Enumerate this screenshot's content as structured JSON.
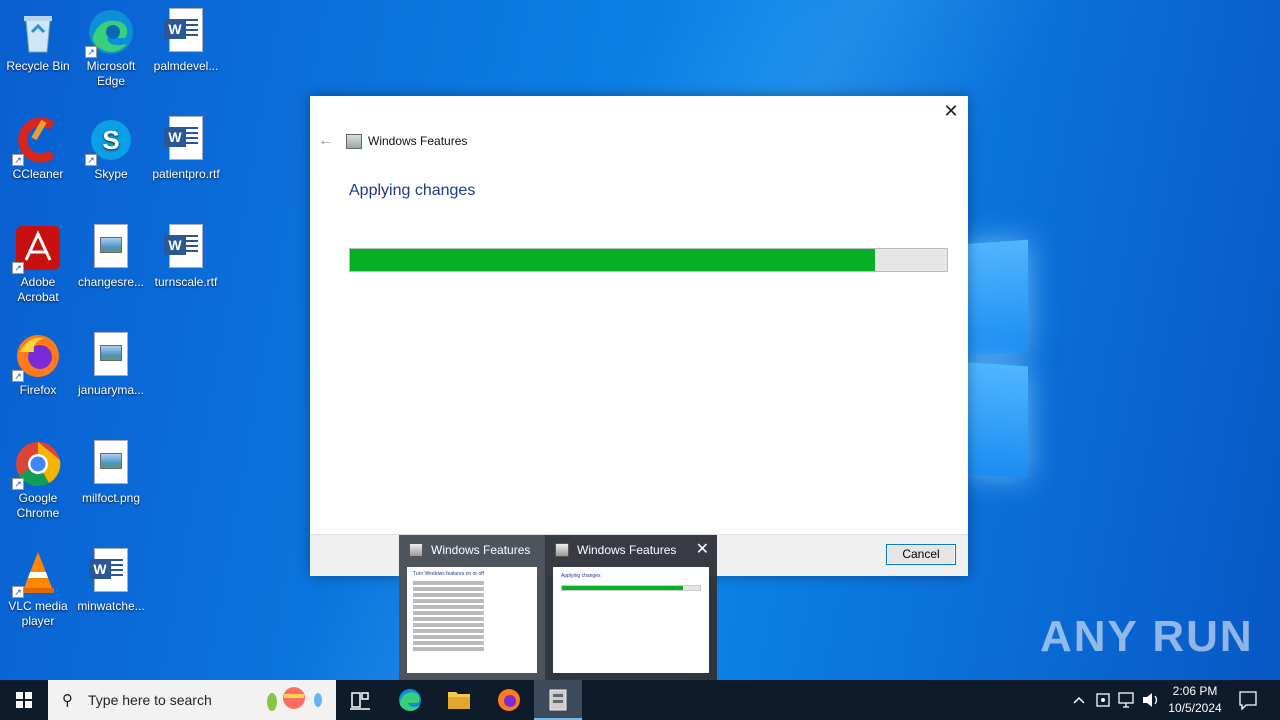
{
  "desktop": {
    "icons": [
      {
        "label": "Recycle Bin",
        "icon": "recycle-bin-icon"
      },
      {
        "label": "Microsoft Edge",
        "icon": "edge-icon"
      },
      {
        "label": "palmdevel...",
        "icon": "word-doc-icon"
      },
      {
        "label": "CCleaner",
        "icon": "ccleaner-icon"
      },
      {
        "label": "Skype",
        "icon": "skype-icon"
      },
      {
        "label": "patientpro.rtf",
        "icon": "word-doc-icon"
      },
      {
        "label": "Adobe Acrobat",
        "icon": "acrobat-icon"
      },
      {
        "label": "changesre...",
        "icon": "image-file-icon"
      },
      {
        "label": "turnscale.rtf",
        "icon": "word-doc-icon"
      },
      {
        "label": "Firefox",
        "icon": "firefox-icon"
      },
      {
        "label": "januaryma...",
        "icon": "image-file-icon"
      },
      {
        "label": "Google Chrome",
        "icon": "chrome-icon"
      },
      {
        "label": "milfoct.png",
        "icon": "image-file-icon"
      },
      {
        "label": "VLC media player",
        "icon": "vlc-icon"
      },
      {
        "label": "minwatche...",
        "icon": "word-doc-icon"
      }
    ]
  },
  "dialog": {
    "title": "Windows Features",
    "heading": "Applying changes",
    "progress": 0.88,
    "progress_color": "#06b025",
    "cancel_label": "Cancel",
    "close_glyph": "✕",
    "back_glyph": "←"
  },
  "thumbnails": {
    "items": [
      {
        "title": "Windows Features",
        "preview_heading": "Turn Windows features on or off"
      },
      {
        "title": "Windows Features",
        "preview_heading": "Applying changes"
      }
    ],
    "close_glyph": "✕"
  },
  "taskbar": {
    "search_placeholder": "Type here to search",
    "clock_time": "2:06 PM",
    "clock_date": "10/5/2024"
  },
  "watermark": "ANY RUN"
}
